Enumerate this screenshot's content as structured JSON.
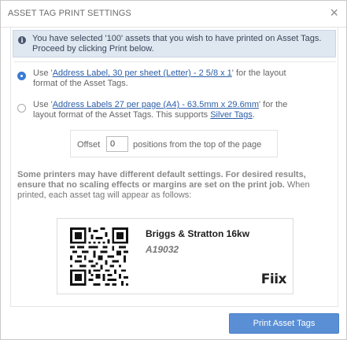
{
  "dialog": {
    "title": "ASSET TAG PRINT SETTINGS",
    "close_glyph": "×"
  },
  "info": {
    "icon": "info-icon",
    "text": "You have selected '100' assets that you wish to have printed on Asset Tags. Proceed by clicking Print below."
  },
  "options": [
    {
      "selected": true,
      "prefix": "Use '",
      "link": "Address Label, 30 per sheet (Letter) - 2 5/8 x 1",
      "middle": "' for the layout format of the Asset Tags.",
      "link2": "",
      "suffix": ""
    },
    {
      "selected": false,
      "prefix": "Use '",
      "link": "Address Labels 27 per page (A4) - 63.5mm x 29.6mm",
      "middle": "' for the layout format of the Asset Tags. This supports ",
      "link2": "Silver Tags",
      "suffix": "."
    }
  ],
  "offset": {
    "label": "Offset",
    "value": "0",
    "suffix": "positions from the top of the page"
  },
  "warning": {
    "bold": "Some printers may have different default settings. For desired results, ensure that no scaling effects or margins are set on the print job.",
    "normal": " When printed, each asset tag will appear as follows:"
  },
  "label_preview": {
    "asset_name": "Briggs & Stratton 16kw",
    "asset_id": "A19032",
    "brand": "Fiix"
  },
  "footer": {
    "print_label": "Print Asset Tags"
  },
  "colors": {
    "accent": "#3a7bd5",
    "button": "#5a8fd6",
    "info_bg": "#dfe7f1",
    "link": "#2c5ea8"
  }
}
